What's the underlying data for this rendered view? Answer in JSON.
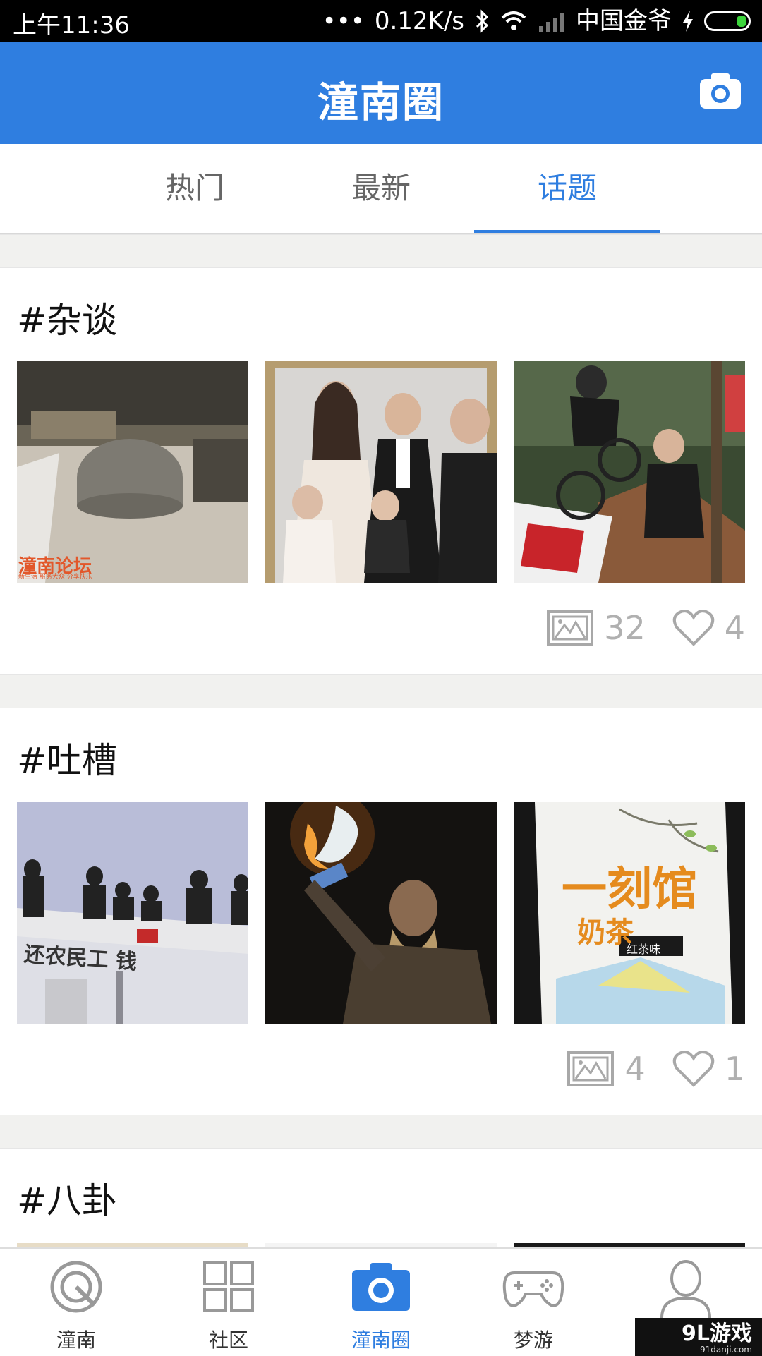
{
  "status_bar": {
    "time": "上午11:36",
    "dots": "•••",
    "speed": "0.12K/s",
    "carrier": "中国金爷",
    "icons": [
      "bluetooth-icon",
      "wifi-icon",
      "signal-icon",
      "charging-icon",
      "battery-icon"
    ]
  },
  "header": {
    "title": "潼南圈",
    "camera_icon": "camera-icon",
    "accent": "#2f7ee0"
  },
  "tabs": [
    {
      "label": "热门",
      "active": false
    },
    {
      "label": "最新",
      "active": false
    },
    {
      "label": "话题",
      "active": true
    }
  ],
  "topics": [
    {
      "name": "#杂谈",
      "thumbs": [
        {
          "desc": "car-over-stone",
          "caption": "潼南论坛",
          "subcaption": "新生活 服务大众 分享快乐"
        },
        {
          "desc": "family-portrait"
        },
        {
          "desc": "mountain-bike-jump"
        }
      ],
      "image_count": "32",
      "like_count": "4"
    },
    {
      "name": "#吐槽",
      "thumbs": [
        {
          "desc": "workers-on-roof",
          "caption": "还农民工 钱"
        },
        {
          "desc": "warrior-torch"
        },
        {
          "desc": "milk-tea-bottle",
          "brand": "一刻馆",
          "product": "奶茶",
          "flavor": "红茶味"
        }
      ],
      "image_count": "4",
      "like_count": "1"
    },
    {
      "name": "#八卦"
    }
  ],
  "bottom_nav": [
    {
      "label": "潼南",
      "icon": "tongnan-icon",
      "active": false
    },
    {
      "label": "社区",
      "icon": "grid-icon",
      "active": false
    },
    {
      "label": "潼南圈",
      "icon": "camera-icon",
      "active": true
    },
    {
      "label": "梦游",
      "icon": "gamepad-icon",
      "active": false
    },
    {
      "label": "",
      "icon": "user-icon",
      "active": false
    }
  ],
  "watermark": {
    "brand": "9L游戏",
    "site": "91danji.com"
  }
}
